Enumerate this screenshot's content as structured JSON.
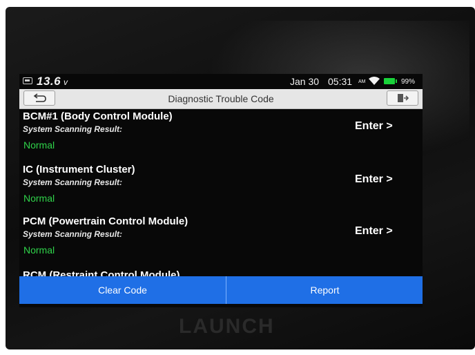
{
  "status_bar": {
    "voltage": "13.6",
    "voltage_unit": "v",
    "date": "Jan 30",
    "time": "05:31",
    "ampm": "AM",
    "battery_percent": "99%"
  },
  "title_bar": {
    "title": "Diagnostic Trouble Code"
  },
  "modules": [
    {
      "name": "BCM#1 (Body Control Module)",
      "scan_label": "System Scanning Result:",
      "result": "Normal",
      "enter_label": "Enter >"
    },
    {
      "name": "IC (Instrument Cluster)",
      "scan_label": "System Scanning Result:",
      "result": "Normal",
      "enter_label": "Enter >"
    },
    {
      "name": "PCM (Powertrain Control Module)",
      "scan_label": "System Scanning Result:",
      "result": "Normal",
      "enter_label": "Enter >"
    }
  ],
  "cut_off_module": "RCM (Restraint Control Module)",
  "bottom_bar": {
    "clear_label": "Clear Code",
    "report_label": "Report"
  },
  "device_brand": "LAUNCH",
  "colors": {
    "accent_blue": "#1f6fe6",
    "normal_green": "#2fd34a",
    "battery_green": "#19d33a"
  }
}
